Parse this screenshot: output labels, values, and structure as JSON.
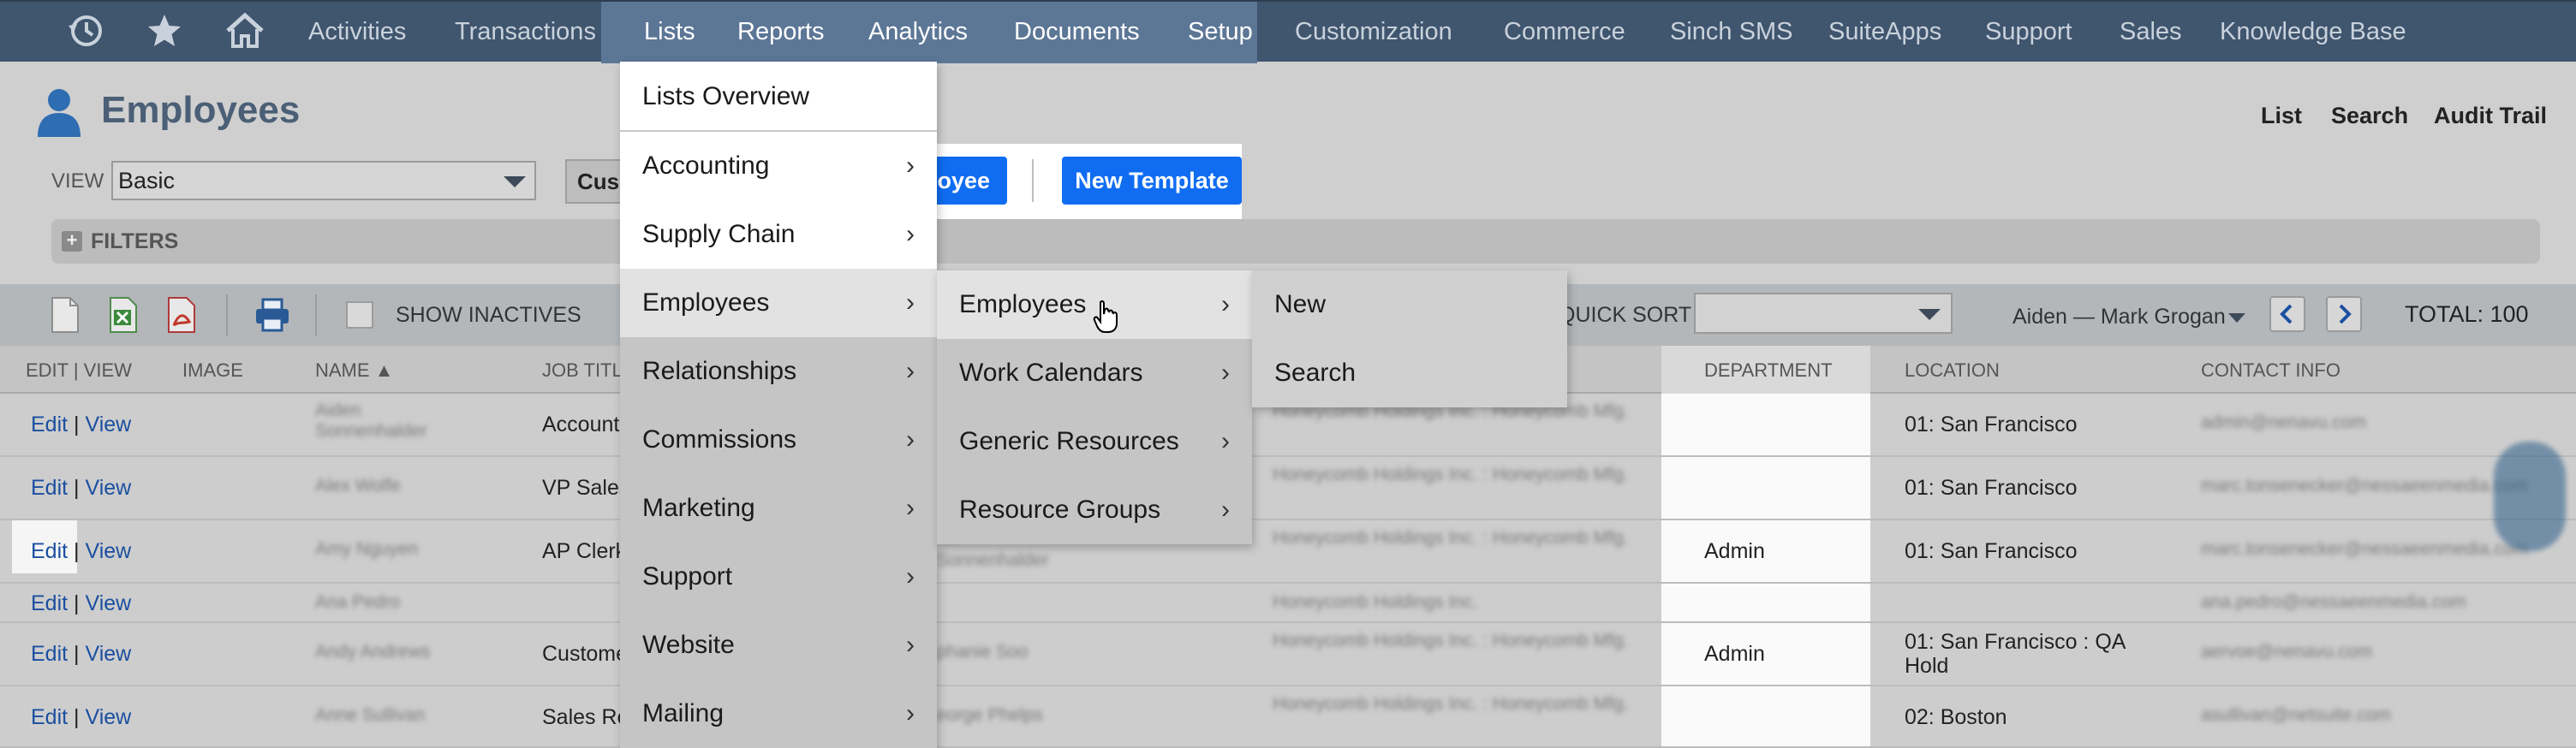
{
  "nav": {
    "icons": [
      "recent-icon",
      "star-icon",
      "home-icon"
    ],
    "items": [
      "Activities",
      "Transactions",
      "Lists",
      "Reports",
      "Analytics",
      "Documents",
      "Setup",
      "Customization",
      "Commerce",
      "Sinch SMS",
      "SuiteApps",
      "Support",
      "Sales",
      "Knowledge Base"
    ],
    "active": "Lists"
  },
  "header": {
    "title": "Employees",
    "links": [
      "List",
      "Search",
      "Audit Trail"
    ]
  },
  "view": {
    "label": "VIEW",
    "value": "Basic"
  },
  "buttons": {
    "customize": "Cus",
    "new_employee": "oyee",
    "new_template": "New Template"
  },
  "filters": {
    "label": "FILTERS",
    "plus": "+"
  },
  "toolbar": {
    "show_inactives": "SHOW INACTIVES",
    "quick_sort": "QUICK SORT",
    "page_range": "Aiden — Mark Grogan",
    "total": "TOTAL: 100"
  },
  "table": {
    "columns": [
      "EDIT | VIEW",
      "IMAGE",
      "NAME ▲",
      "JOB TITLE",
      "DEPARTMENT",
      "LOCATION",
      "CONTACT INFO"
    ],
    "rows": [
      {
        "name": "Aiden Sonnenhalder",
        "job": "Accounti",
        "sub": "Honeycomb Holdings Inc. : Honeycomb Mfg.",
        "supervisor": "",
        "department": "",
        "location": "01: San Francisco",
        "contact": "admin@nenavu.com"
      },
      {
        "name": "Alex Wolfe",
        "job": "VP Sales",
        "sub": "Honeycomb Holdings Inc. : Honeycomb Mfg.",
        "supervisor": "",
        "department": "",
        "location": "01: San Francisco",
        "contact": "marc.tonsenecker@nessaeenmedia.com"
      },
      {
        "name": "Amy Nguyen",
        "job": "AP Clerk",
        "sub": "Honeycomb Holdings Inc. : Honeycomb Mfg.",
        "supervisor": "ich Sonnenhalder",
        "department": "Admin",
        "location": "01: San Francisco",
        "contact": "marc.tonsenecker@nessaeenmedia.com"
      },
      {
        "name": "Ana Pedro",
        "job": "",
        "sub": "Honeycomb Holdings Inc.",
        "supervisor": "",
        "department": "",
        "location": "",
        "contact": "ana.pedro@nessaeenmedia.com"
      },
      {
        "name": "Andy Andrews",
        "job": "Custome",
        "sub": "Honeycomb Holdings Inc. : Honeycomb Mfg.",
        "supervisor": "phanie Soo",
        "department": "Admin",
        "location": "01: San Francisco : QA Hold",
        "contact": "aervoe@nenavu.com"
      },
      {
        "name": "Anne Sullivan",
        "job": "Sales Re",
        "sub": "Honeycomb Holdings Inc. : Honeycomb Mfg.",
        "supervisor": "eorge Phelps",
        "department": "",
        "location": "02: Boston",
        "contact": "asullivan@netsuite.com"
      }
    ],
    "edit": "Edit",
    "view": "View",
    "sep": "|"
  },
  "menu": {
    "overview": "Lists Overview",
    "col1": [
      "Accounting",
      "Supply Chain",
      "Employees",
      "Relationships",
      "Commissions",
      "Marketing",
      "Support",
      "Website",
      "Mailing"
    ],
    "col2": [
      "Employees",
      "Work Calendars",
      "Generic Resources",
      "Resource Groups"
    ],
    "col3": [
      "New",
      "Search"
    ],
    "chevron": "›"
  },
  "colors": {
    "nav_bg": "#40556e",
    "nav_highlight": "#5c7696",
    "button_blue": "#106df2",
    "title": "#4b5f76",
    "link": "#1b4fa0"
  }
}
